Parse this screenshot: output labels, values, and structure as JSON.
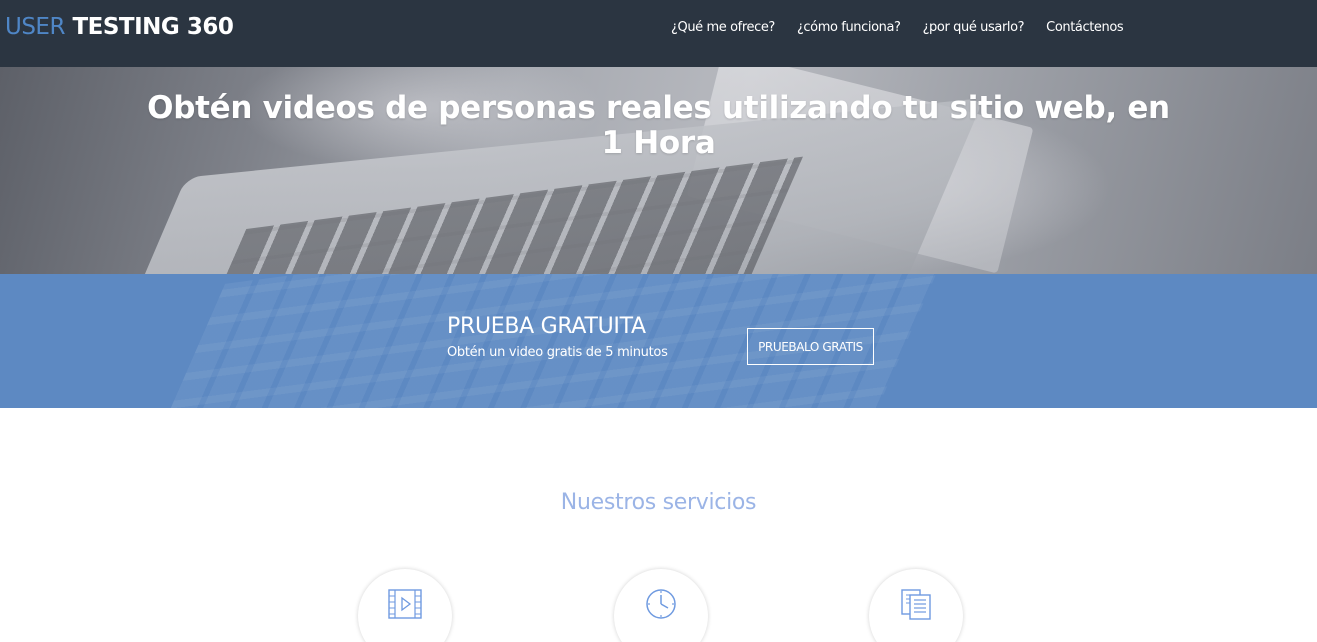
{
  "header": {
    "brand_part1": "USER",
    "brand_part2": "TESTING 360",
    "nav": [
      {
        "label": "¿Qué me ofrece?"
      },
      {
        "label": "¿cómo funciona?"
      },
      {
        "label": "¿por qué usarlo?"
      },
      {
        "label": "Contáctenos"
      }
    ]
  },
  "hero": {
    "title_line1": "Obtén videos de personas reales utilizando tu sitio web, en",
    "title_line2": "1 Hora"
  },
  "cta": {
    "title": "PRUEBA GRATUITA",
    "subtitle": "Obtén un video gratis de 5 minutos",
    "button_label": "PRUEBALO GRATIS"
  },
  "services": {
    "title": "Nuestros servicios",
    "icons": [
      "video-icon",
      "clock-icon",
      "document-icon"
    ]
  },
  "colors": {
    "navbar": "#2b3541",
    "brand_accent": "#4f86c6",
    "cta_band": "#5d89c2",
    "services_title": "#9bb4e6",
    "icon_stroke": "#6f9ae0"
  }
}
